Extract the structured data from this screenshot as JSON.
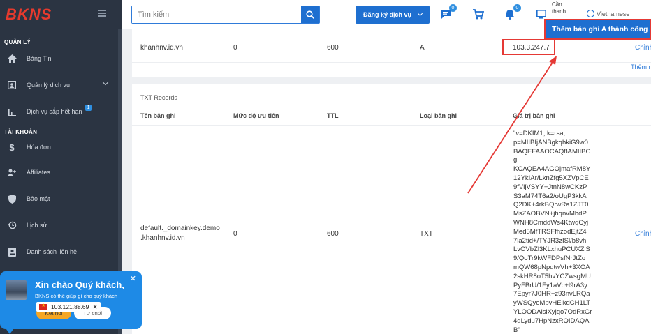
{
  "brand": {
    "logo_text": "BKNS",
    "accent": "#1e6fd0",
    "logo_color": "#e63a2e",
    "sidebar_bg": "#2b3442"
  },
  "sidebar": {
    "section_account_mgmt": "QUẢN LÝ",
    "section_account": "TÀI KHOẢN",
    "items": [
      {
        "label": "Bảng Tin",
        "icon": "home-icon"
      },
      {
        "label": "Quản lý dịch vụ",
        "icon": "contact-card-icon"
      },
      {
        "label": "Dịch vụ sắp hết hạn",
        "icon": "bar-chart-icon",
        "badge": "1"
      },
      {
        "label": "Hóa đơn",
        "icon": "dollar-icon"
      },
      {
        "label": "Affiliates",
        "icon": "users-add-icon"
      },
      {
        "label": "Bảo mật",
        "icon": "shield-icon"
      },
      {
        "label": "Lịch sử",
        "icon": "history-icon"
      },
      {
        "label": "Danh sách liên hệ",
        "icon": "contacts-list-icon"
      }
    ]
  },
  "topbar": {
    "search_placeholder": "Tìm kiếm",
    "register_label": "Đăng ký dịch vụ",
    "chat_badge": "0",
    "notif_badge": "0",
    "cant_thanh_label": "Cần thanh",
    "language": "Vietnamese"
  },
  "toast": {
    "message": "Thêm bản ghi A thành công"
  },
  "a_record": {
    "name": "khanhnv.id.vn",
    "priority": "0",
    "ttl": "600",
    "type": "A",
    "value": "103.3.247.7",
    "edit_label": "Chỉnh",
    "add_label": "Thêm r"
  },
  "txt_section": {
    "title": "TXT Records",
    "headers": [
      "Tên bản ghi",
      "Mức độ ưu tiên",
      "TTL",
      "Loại bản ghi",
      "Giá trị bản ghi"
    ],
    "row": {
      "name_line1": "default._domainkey.demo",
      "name_line2": ".khanhnv.id.vn",
      "priority": "0",
      "ttl": "600",
      "type": "TXT",
      "value_lines": [
        "\"v=DKIM1; k=rsa;",
        "p=MIIBIjANBgkqhkiG9w0",
        "BAQEFAAOCAQ8AMIIBCg",
        "KCAQEA4AGOjmafRM8Y",
        "12YkIAr/LknZfg5XZVpCE",
        "9fVljVSYY+JtnN8wCKzP",
        "S3aM74T6a2/oUgP3kkA",
        "Q2DK+4rkBQrwRa1ZJT0",
        "MsZAOBVN+jhqnvMbdP",
        "WNH8CmddWs4KtwqCyj",
        "Med5MfTRSFfhzodEjtZ4",
        "7la2tid+/TYJR3zISl/b8vh",
        "LvOVbZl3KLxhuPCUXZlS",
        "9/QoTr9kWFDPsfNrJtZo",
        "mQW68pNpqtwVh+3XOA",
        "2skHR8oT5hvYCZwsgMU",
        "PyFBrU/1Fy1aVc+l9rA3y",
        "7Epyr7J0HR+z93nvLRQa",
        "yWSQyeMpvHElkdCH1LT",
        "YLOODAlslXyjqo7OdRxGr",
        "4qLydu7HpNzxRQIDAQA",
        "B\""
      ],
      "edit_label": "Chỉnh"
    }
  },
  "chat_widget": {
    "title": "Xin chào Quý khách,",
    "subtitle": "BKNS có thể giúp gì cho quý khách",
    "ip": "103.121.88.69",
    "connect_label": "Kết nối",
    "decline_label": "Từ chối"
  }
}
